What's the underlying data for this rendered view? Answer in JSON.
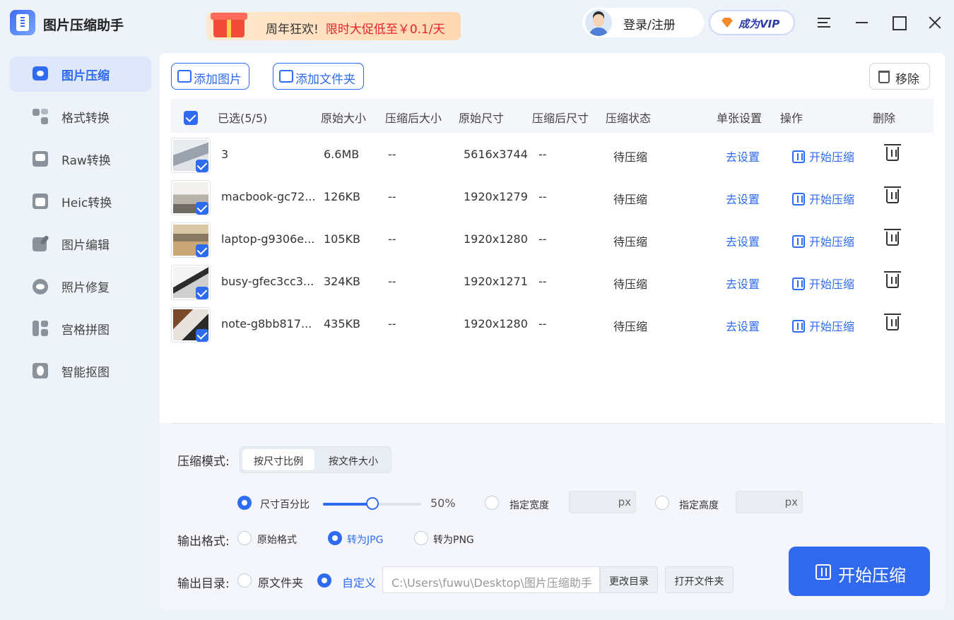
{
  "app": {
    "title": "图片压缩助手"
  },
  "promo": {
    "prefix": "周年狂欢!",
    "text": "限时大促低至￥0.1/天"
  },
  "account": {
    "login_label": "登录/注册",
    "vip_label": "成为VIP"
  },
  "sidebar": {
    "items": [
      {
        "label": "图片压缩",
        "icon": "image-compress-icon",
        "active": true
      },
      {
        "label": "格式转换",
        "icon": "format-convert-icon",
        "active": false
      },
      {
        "label": "Raw转换",
        "icon": "raw-convert-icon",
        "active": false
      },
      {
        "label": "Heic转换",
        "icon": "heic-convert-icon",
        "active": false
      },
      {
        "label": "图片编辑",
        "icon": "image-edit-icon",
        "active": false
      },
      {
        "label": "照片修复",
        "icon": "photo-repair-icon",
        "active": false
      },
      {
        "label": "宫格拼图",
        "icon": "grid-collage-icon",
        "active": false
      },
      {
        "label": "智能抠图",
        "icon": "smart-cutout-icon",
        "active": false
      }
    ]
  },
  "toolbar": {
    "add_images": "添加图片",
    "add_folder": "添加文件夹",
    "remove": "移除"
  },
  "table": {
    "headers": {
      "selected": "已选(5/5)",
      "orig_size": "原始大小",
      "comp_size": "压缩后大小",
      "orig_dim": "原始尺寸",
      "comp_dim": "压缩后尺寸",
      "status": "压缩状态",
      "settings": "单张设置",
      "action": "操作",
      "delete": "删除"
    },
    "rows": [
      {
        "name": "3",
        "orig_size": "6.6MB",
        "comp_size": "--",
        "orig_dim": "5616x3744",
        "comp_dim": "--",
        "status": "待压缩",
        "settings": "去设置",
        "action": "开始压缩"
      },
      {
        "name": "macbook-gc72...",
        "orig_size": "126KB",
        "comp_size": "--",
        "orig_dim": "1920x1279",
        "comp_dim": "--",
        "status": "待压缩",
        "settings": "去设置",
        "action": "开始压缩"
      },
      {
        "name": "laptop-g9306e...",
        "orig_size": "105KB",
        "comp_size": "--",
        "orig_dim": "1920x1280",
        "comp_dim": "--",
        "status": "待压缩",
        "settings": "去设置",
        "action": "开始压缩"
      },
      {
        "name": "busy-gfec3cc3...",
        "orig_size": "324KB",
        "comp_size": "--",
        "orig_dim": "1920x1271",
        "comp_dim": "--",
        "status": "待压缩",
        "settings": "去设置",
        "action": "开始压缩"
      },
      {
        "name": "note-g8bb817...",
        "orig_size": "435KB",
        "comp_size": "--",
        "orig_dim": "1920x1280",
        "comp_dim": "--",
        "status": "待压缩",
        "settings": "去设置",
        "action": "开始压缩"
      }
    ]
  },
  "compress": {
    "mode_label": "压缩模式:",
    "mode_options": [
      "按尺寸比例",
      "按文件大小"
    ],
    "mode_selected": "按尺寸比例",
    "percent_label": "尺寸百分比",
    "percent_value": "50%",
    "percent_fraction": 0.5,
    "width_label": "指定宽度",
    "height_label": "指定高度",
    "unit": "px"
  },
  "output_format": {
    "label": "输出格式:",
    "options": [
      "原始格式",
      "转为JPG",
      "转为PNG"
    ],
    "selected": "转为JPG"
  },
  "output_dir": {
    "label": "输出目录:",
    "options": [
      "原文件夹",
      "自定义"
    ],
    "selected": "自定义",
    "path": "C:\\Users\\fuwu\\Desktop\\图片压缩助手",
    "change_button": "更改目录",
    "open_button": "打开文件夹"
  },
  "start_button": "开始压缩",
  "colors": {
    "accent": "#2f6bef",
    "start_button": "#3169ee",
    "promo_red": "#e6242b"
  }
}
